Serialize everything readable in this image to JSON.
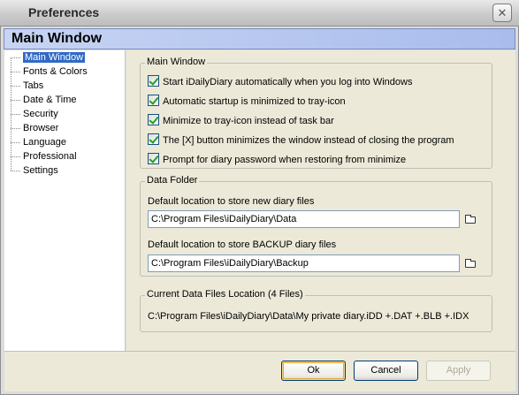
{
  "window": {
    "title": "Preferences",
    "close_glyph": "✕"
  },
  "header": {
    "title": "Main Window"
  },
  "sidebar": {
    "items": [
      {
        "label": "Main Window",
        "selected": true
      },
      {
        "label": "Fonts & Colors"
      },
      {
        "label": "Tabs"
      },
      {
        "label": "Date & Time"
      },
      {
        "label": "Security"
      },
      {
        "label": "Browser"
      },
      {
        "label": "Language"
      },
      {
        "label": "Professional"
      },
      {
        "label": "Settings"
      }
    ]
  },
  "main_window_group": {
    "label": "Main Window",
    "options": [
      {
        "label": "Start iDailyDiary automatically when you log into Windows",
        "checked": true
      },
      {
        "label": "Automatic startup is minimized to tray-icon",
        "checked": true
      },
      {
        "label": "Minimize to tray-icon instead of task bar",
        "checked": true
      },
      {
        "label": "The [X] button minimizes the window instead of closing the program",
        "checked": true
      },
      {
        "label": "Prompt for diary password when restoring from minimize",
        "checked": true
      }
    ]
  },
  "data_folder_group": {
    "label": "Data Folder",
    "new_files_label": "Default location to store new diary files",
    "new_files_path": "C:\\Program Files\\iDailyDiary\\Data",
    "backup_label": "Default location to store BACKUP diary files",
    "backup_path": "C:\\Program Files\\iDailyDiary\\Backup"
  },
  "current_location_group": {
    "label": "Current Data Files Location (4 Files)",
    "value": "C:\\Program Files\\iDailyDiary\\Data\\My private diary.iDD +.DAT +.BLB +.IDX"
  },
  "buttons": {
    "ok": "Ok",
    "cancel": "Cancel",
    "apply": "Apply"
  },
  "icons": {
    "browse": "folder-icon"
  }
}
